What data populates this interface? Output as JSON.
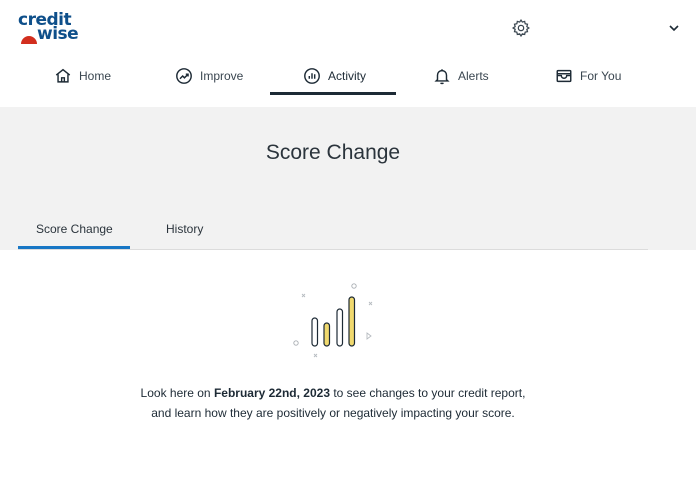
{
  "brand": {
    "logo_line1": "credit",
    "logo_line2": "wise",
    "colors": {
      "logo": "#0e4f8a",
      "arc": "#d22e1e",
      "accent": "#1877c5",
      "illustration_fill": "#f0d96e"
    }
  },
  "header": {
    "settings_icon": "gear-icon",
    "menu_icon": "chevron-down-icon"
  },
  "nav": {
    "items": [
      {
        "label": "Home",
        "icon": "home-icon"
      },
      {
        "label": "Improve",
        "icon": "trending-up-icon"
      },
      {
        "label": "Activity",
        "icon": "bar-chart-icon",
        "active": true
      },
      {
        "label": "Alerts",
        "icon": "bell-icon"
      },
      {
        "label": "For You",
        "icon": "wallet-icon"
      }
    ]
  },
  "banner": {
    "title": "Score Change"
  },
  "tabs": [
    {
      "label": "Score Change",
      "active": true
    },
    {
      "label": "History"
    }
  ],
  "empty_state": {
    "illustration": "bar-chart-illustration",
    "text_before": "Look here on ",
    "date": "February 22nd, 2023",
    "text_after": " to see changes to your credit report,",
    "line2": "and learn how they are positively or negatively impacting your score."
  }
}
